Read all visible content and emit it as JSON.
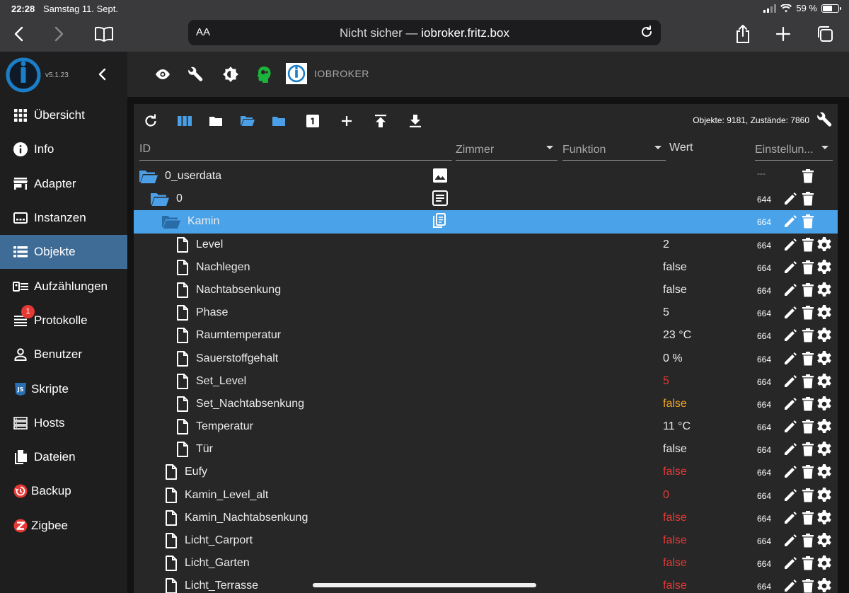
{
  "status": {
    "time": "22:28",
    "date": "Samstag 11. Sept.",
    "battery": "59 %"
  },
  "browser": {
    "aa": "AA",
    "url_prefix": "Nicht sicher — ",
    "url_host": "iobroker.fritz.box"
  },
  "sidebar": {
    "version": "v5.1.23",
    "items": [
      {
        "label": "Übersicht",
        "icon": "grid-icon"
      },
      {
        "label": "Info",
        "icon": "info-icon"
      },
      {
        "label": "Adapter",
        "icon": "store-icon"
      },
      {
        "label": "Instanzen",
        "icon": "instances-icon"
      },
      {
        "label": "Objekte",
        "icon": "list-icon"
      },
      {
        "label": "Aufzählungen",
        "icon": "enum-icon"
      },
      {
        "label": "Protokolle",
        "icon": "log-icon",
        "badge": "1"
      },
      {
        "label": "Benutzer",
        "icon": "user-icon"
      },
      {
        "label": "Skripte",
        "icon": "js-icon"
      },
      {
        "label": "Hosts",
        "icon": "hosts-icon"
      },
      {
        "label": "Dateien",
        "icon": "files-icon"
      },
      {
        "label": "Backup",
        "icon": "backup-icon"
      },
      {
        "label": "Zigbee",
        "icon": "zigbee-icon"
      }
    ]
  },
  "header": {
    "title": "IOBROKER"
  },
  "toolbar": {
    "counts": "Objekte: 9181, Zustände: 7860"
  },
  "columns": {
    "id": "ID",
    "room": "Zimmer",
    "function": "Funktion",
    "value": "Wert",
    "settings": "Einstellun..."
  },
  "rows": [
    {
      "name": "0_userdata",
      "type": "folder",
      "value": "",
      "acl": "---"
    },
    {
      "name": "0",
      "type": "folder",
      "value": "",
      "acl": "644"
    },
    {
      "name": "Kamin",
      "type": "folder",
      "value": "",
      "acl": "664"
    },
    {
      "name": "Level",
      "type": "state",
      "value": "2",
      "acl": "664"
    },
    {
      "name": "Nachlegen",
      "type": "state",
      "value": "false",
      "acl": "664"
    },
    {
      "name": "Nachtabsenkung",
      "type": "state",
      "value": "false",
      "acl": "664"
    },
    {
      "name": "Phase",
      "type": "state",
      "value": "5",
      "acl": "664"
    },
    {
      "name": "Raumtemperatur",
      "type": "state",
      "value": "23 °C",
      "acl": "664"
    },
    {
      "name": "Sauerstoffgehalt",
      "type": "state",
      "value": "0 %",
      "acl": "664"
    },
    {
      "name": "Set_Level",
      "type": "state",
      "value": "5",
      "acl": "664"
    },
    {
      "name": "Set_Nachtabsenkung",
      "type": "state",
      "value": "false",
      "acl": "664"
    },
    {
      "name": "Temperatur",
      "type": "state",
      "value": "11 °C",
      "acl": "664"
    },
    {
      "name": "Tür",
      "type": "state",
      "value": "false",
      "acl": "664"
    },
    {
      "name": "Eufy",
      "type": "state",
      "value": "false",
      "acl": "664"
    },
    {
      "name": "Kamin_Level_alt",
      "type": "state",
      "value": "0",
      "acl": "664"
    },
    {
      "name": "Kamin_Nachtabsenkung",
      "type": "state",
      "value": "false",
      "acl": "664"
    },
    {
      "name": "Licht_Carport",
      "type": "state",
      "value": "false",
      "acl": "664"
    },
    {
      "name": "Licht_Garten",
      "type": "state",
      "value": "false",
      "acl": "664"
    },
    {
      "name": "Licht_Terrasse",
      "type": "state",
      "value": "false",
      "acl": "664"
    }
  ],
  "colors": {
    "accent": "#3f6b97",
    "selected_row": "#4aa3e8",
    "folder": "#4a9fe6",
    "value_red": "#e53935",
    "value_orange": "#f5a623"
  }
}
